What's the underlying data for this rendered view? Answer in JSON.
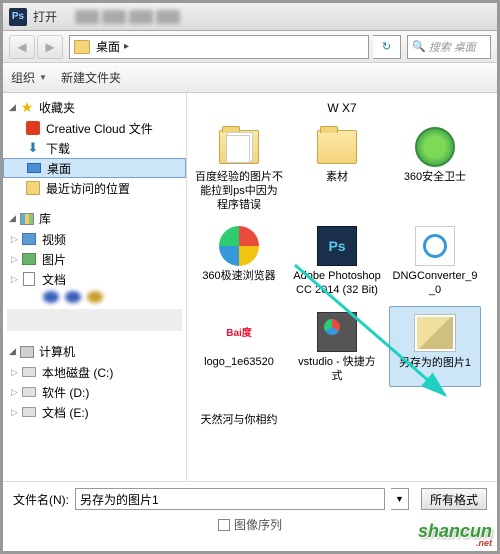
{
  "title": "打开",
  "breadcrumb": {
    "location": "桌面"
  },
  "search": {
    "placeholder": "搜索 桌面"
  },
  "toolbar": {
    "organize": "组织",
    "new_folder": "新建文件夹"
  },
  "sidebar": {
    "favorites": {
      "label": "收藏夹"
    },
    "fav_items": [
      {
        "label": "Creative Cloud 文件"
      },
      {
        "label": "下载"
      },
      {
        "label": "桌面"
      },
      {
        "label": "最近访问的位置"
      }
    ],
    "libraries": {
      "label": "库"
    },
    "lib_items": [
      {
        "label": "视频"
      },
      {
        "label": "图片"
      },
      {
        "label": "文档"
      }
    ],
    "computer": {
      "label": "计算机"
    },
    "comp_items": [
      {
        "label": "本地磁盘 (C:)"
      },
      {
        "label": "软件 (D:)"
      },
      {
        "label": "文档 (E:)"
      }
    ]
  },
  "content": {
    "header_row": "W X7",
    "items": [
      {
        "label": "百度经验的图片不能拉到ps中因为程序错误"
      },
      {
        "label": "素材"
      },
      {
        "label": "360安全卫士"
      },
      {
        "label": "360极速浏览器"
      },
      {
        "label": "Adobe Photoshop CC 2014 (32 Bit)"
      },
      {
        "label": "DNGConverter_9_0"
      },
      {
        "label": "logo_1e63520"
      },
      {
        "label": "vstudio - 快捷方式"
      },
      {
        "label": "另存为的图片1"
      },
      {
        "label": "天然河与你相约"
      }
    ]
  },
  "bottom": {
    "filename_label": "文件名(N):",
    "filename_value": "另存为的图片1",
    "filter_label": "所有格式",
    "sequence_label": "图像序列"
  },
  "watermark": {
    "text": "shancun",
    "sub": ".net"
  }
}
